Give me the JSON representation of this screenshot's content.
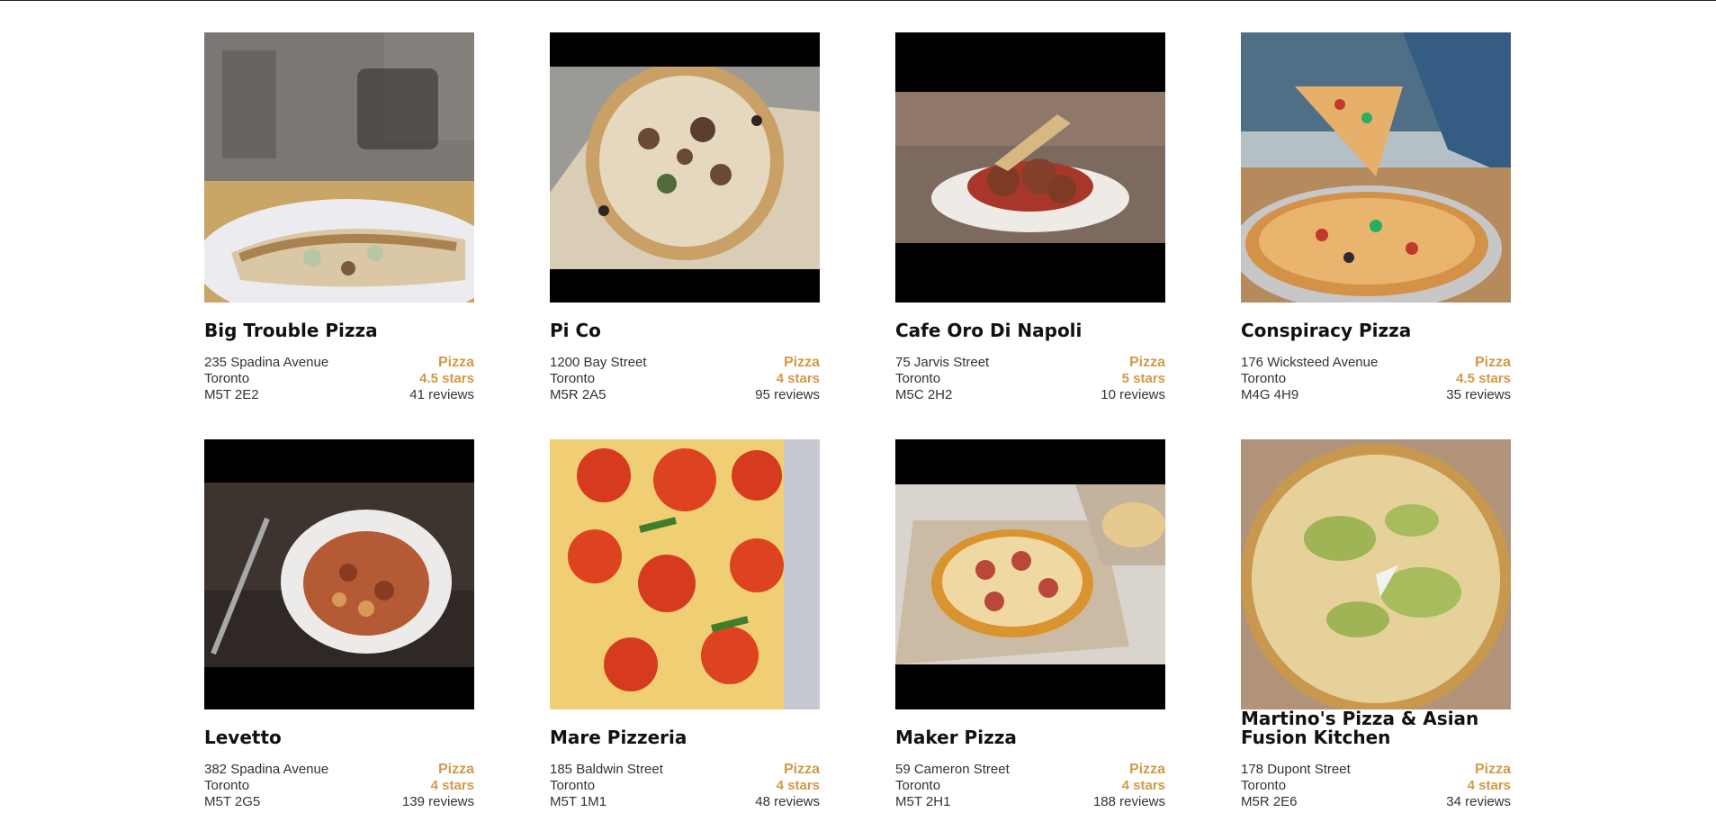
{
  "colors": {
    "accent": "#d29a48",
    "text": "#111111",
    "letterbox": "#000000"
  },
  "restaurants": [
    {
      "name": "Big Trouble Pizza",
      "address": "235 Spadina Avenue",
      "city": "Toronto",
      "postal": "M5T 2E2",
      "category": "Pizza",
      "rating": "4.5 stars",
      "reviews": "41 reviews",
      "photo": "pizza-slices-on-plate"
    },
    {
      "name": "Pi Co",
      "address": "1200 Bay Street",
      "city": "Toronto",
      "postal": "M5R 2A5",
      "category": "Pizza",
      "rating": "4 stars",
      "reviews": "95 reviews",
      "photo": "whole-pizza-on-paper"
    },
    {
      "name": "Cafe Oro Di Napoli",
      "address": "75 Jarvis Street",
      "city": "Toronto",
      "postal": "M5C 2H2",
      "category": "Pizza",
      "rating": "5 stars",
      "reviews": "10 reviews",
      "photo": "meatball-dish"
    },
    {
      "name": "Conspiracy Pizza",
      "address": "176 Wicksteed Avenue",
      "city": "Toronto",
      "postal": "M4G 4H9",
      "category": "Pizza",
      "rating": "4.5 stars",
      "reviews": "35 reviews",
      "photo": "pizza-slice-lift"
    },
    {
      "name": "Levetto",
      "address": "382 Spadina Avenue",
      "city": "Toronto",
      "postal": "M5T 2G5",
      "category": "Pizza",
      "rating": "4 stars",
      "reviews": "139 reviews",
      "photo": "pasta-bowl"
    },
    {
      "name": "Mare Pizzeria",
      "address": "185 Baldwin Street",
      "city": "Toronto",
      "postal": "M5T 1M1",
      "category": "Pizza",
      "rating": "4 stars",
      "reviews": "48 reviews",
      "photo": "pepperoni-closeup"
    },
    {
      "name": "Maker Pizza",
      "address": "59 Cameron Street",
      "city": "Toronto",
      "postal": "M5T 2H1",
      "category": "Pizza",
      "rating": "4 stars",
      "reviews": "188 reviews",
      "photo": "pizza-in-box"
    },
    {
      "name": "Martino's Pizza & Asian Fusion Kitchen",
      "address": "178 Dupont Street",
      "city": "Toronto",
      "postal": "M5R 2E6",
      "category": "Pizza",
      "rating": "4 stars",
      "reviews": "34 reviews",
      "photo": "large-pizza-in-box"
    }
  ]
}
